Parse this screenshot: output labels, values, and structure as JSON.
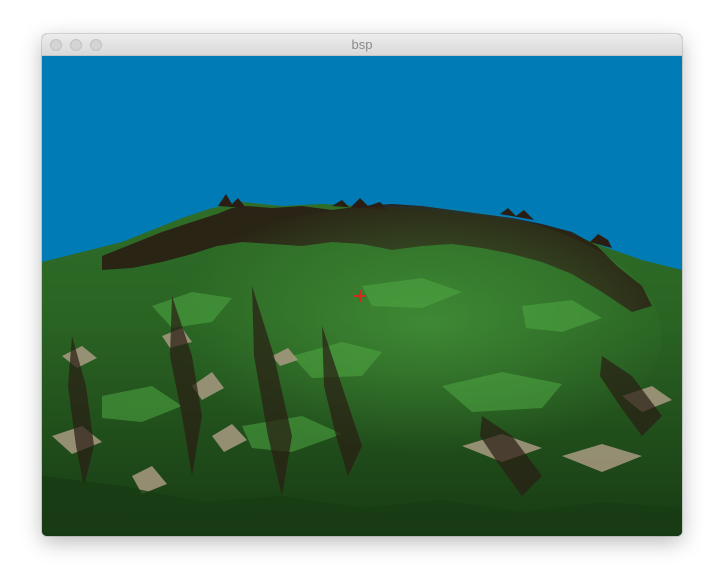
{
  "window": {
    "title": "bsp"
  },
  "scene": {
    "sky_color": "#007bb5",
    "terrain_dark": "#1b3d16",
    "terrain_mid": "#2a6a25",
    "terrain_light": "#4fa843",
    "ridge_color": "#2a1d14",
    "rock_color": "#a99a82",
    "crosshair_color": "#d42a1a"
  }
}
